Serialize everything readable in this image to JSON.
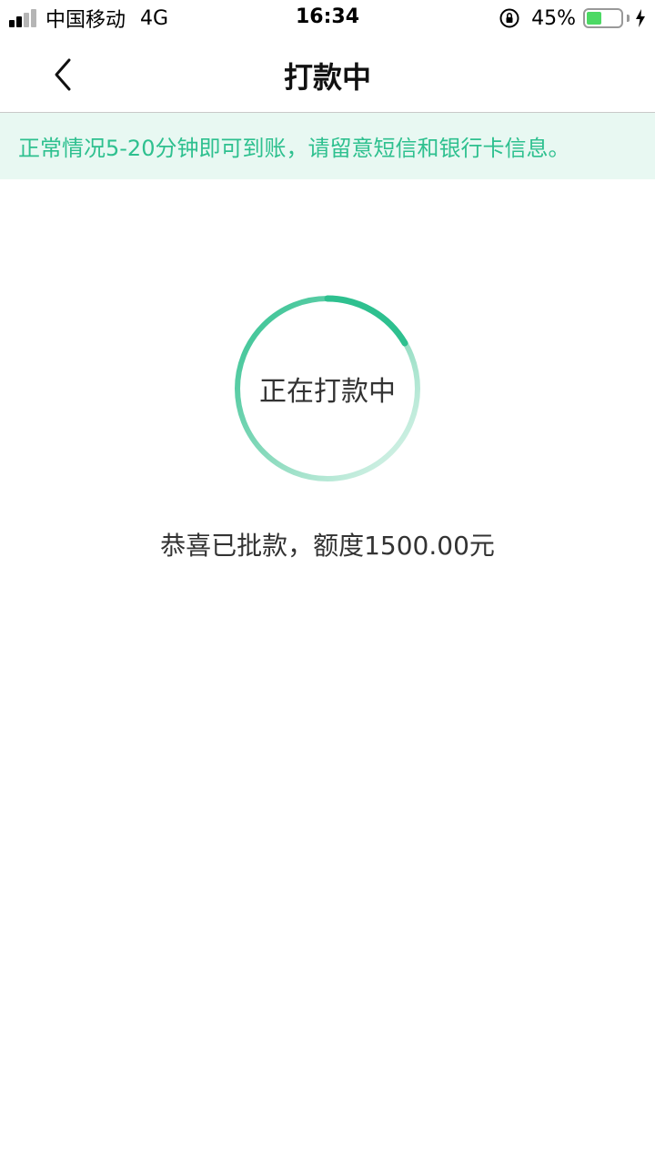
{
  "status_bar": {
    "carrier": "中国移动",
    "network": "4G",
    "time": "16:34",
    "battery_percent": "45%",
    "battery_level": 0.45,
    "signal_bars_filled": 2,
    "signal_bars_total": 4
  },
  "nav": {
    "title": "打款中",
    "back_icon": "chevron-left-icon"
  },
  "notice": {
    "text": "正常情况5-20分钟即可到账，请留意短信和银行卡信息。"
  },
  "progress": {
    "label": "正在打款中"
  },
  "approval": {
    "text": "恭喜已批款，额度1500.00元"
  },
  "colors": {
    "accent": "#2ec08f",
    "notice_bg": "#e8f8f2",
    "battery_fill": "#4cd964"
  }
}
